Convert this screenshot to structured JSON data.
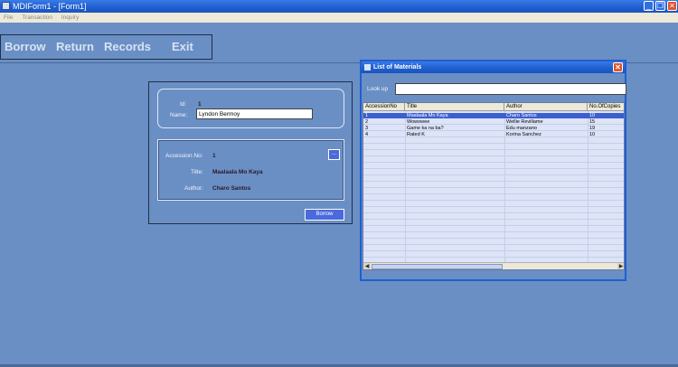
{
  "window": {
    "title": "MDIForm1 - [Form1]",
    "minimize_glyph": "_",
    "restore_glyph": "❐",
    "close_glyph": "✕"
  },
  "menu": {
    "items": [
      "File",
      "Transaction",
      "Inquiry"
    ]
  },
  "toolbar": {
    "borrow": "Borrow",
    "return": "Return",
    "records": "Records",
    "exit": "Exit"
  },
  "borrow_form": {
    "id_label": "Id:",
    "id_value": "1",
    "name_label": "Name:",
    "name_value": "Lyndon Bermoy",
    "accession_label": "Accession No:",
    "accession_value": "1",
    "title_label": "Title:",
    "title_value": "Maalaala Mo Kaya",
    "author_label": "Author:",
    "author_value": "Charo Santos",
    "browse_label": "...",
    "borrow_button": "Borrow"
  },
  "list_window": {
    "title": "List of Materials",
    "close_glyph": "✕",
    "lookup_label": "Look up",
    "lookup_value": "",
    "columns": [
      "AccessionNo",
      "Title",
      "Author",
      "No.OfCopies"
    ],
    "rows": [
      [
        "1",
        "Maalaala Mo Kaya",
        "Charo Santos",
        "10"
      ],
      [
        "2",
        "Wowowee",
        "Wellie Revillame",
        "15"
      ],
      [
        "3",
        "Game ka na ba?",
        "Edu manzano",
        "19"
      ],
      [
        "4",
        "Rated K",
        "Korina Sanchez",
        "10"
      ]
    ],
    "selected_row": 0,
    "scroll_left": "◀",
    "scroll_right": "▶"
  },
  "colors": {
    "background": "#6a8fc4",
    "titlebar": "#1f5fcf",
    "selection": "#3b5fcf",
    "button": "#4a6adc"
  }
}
